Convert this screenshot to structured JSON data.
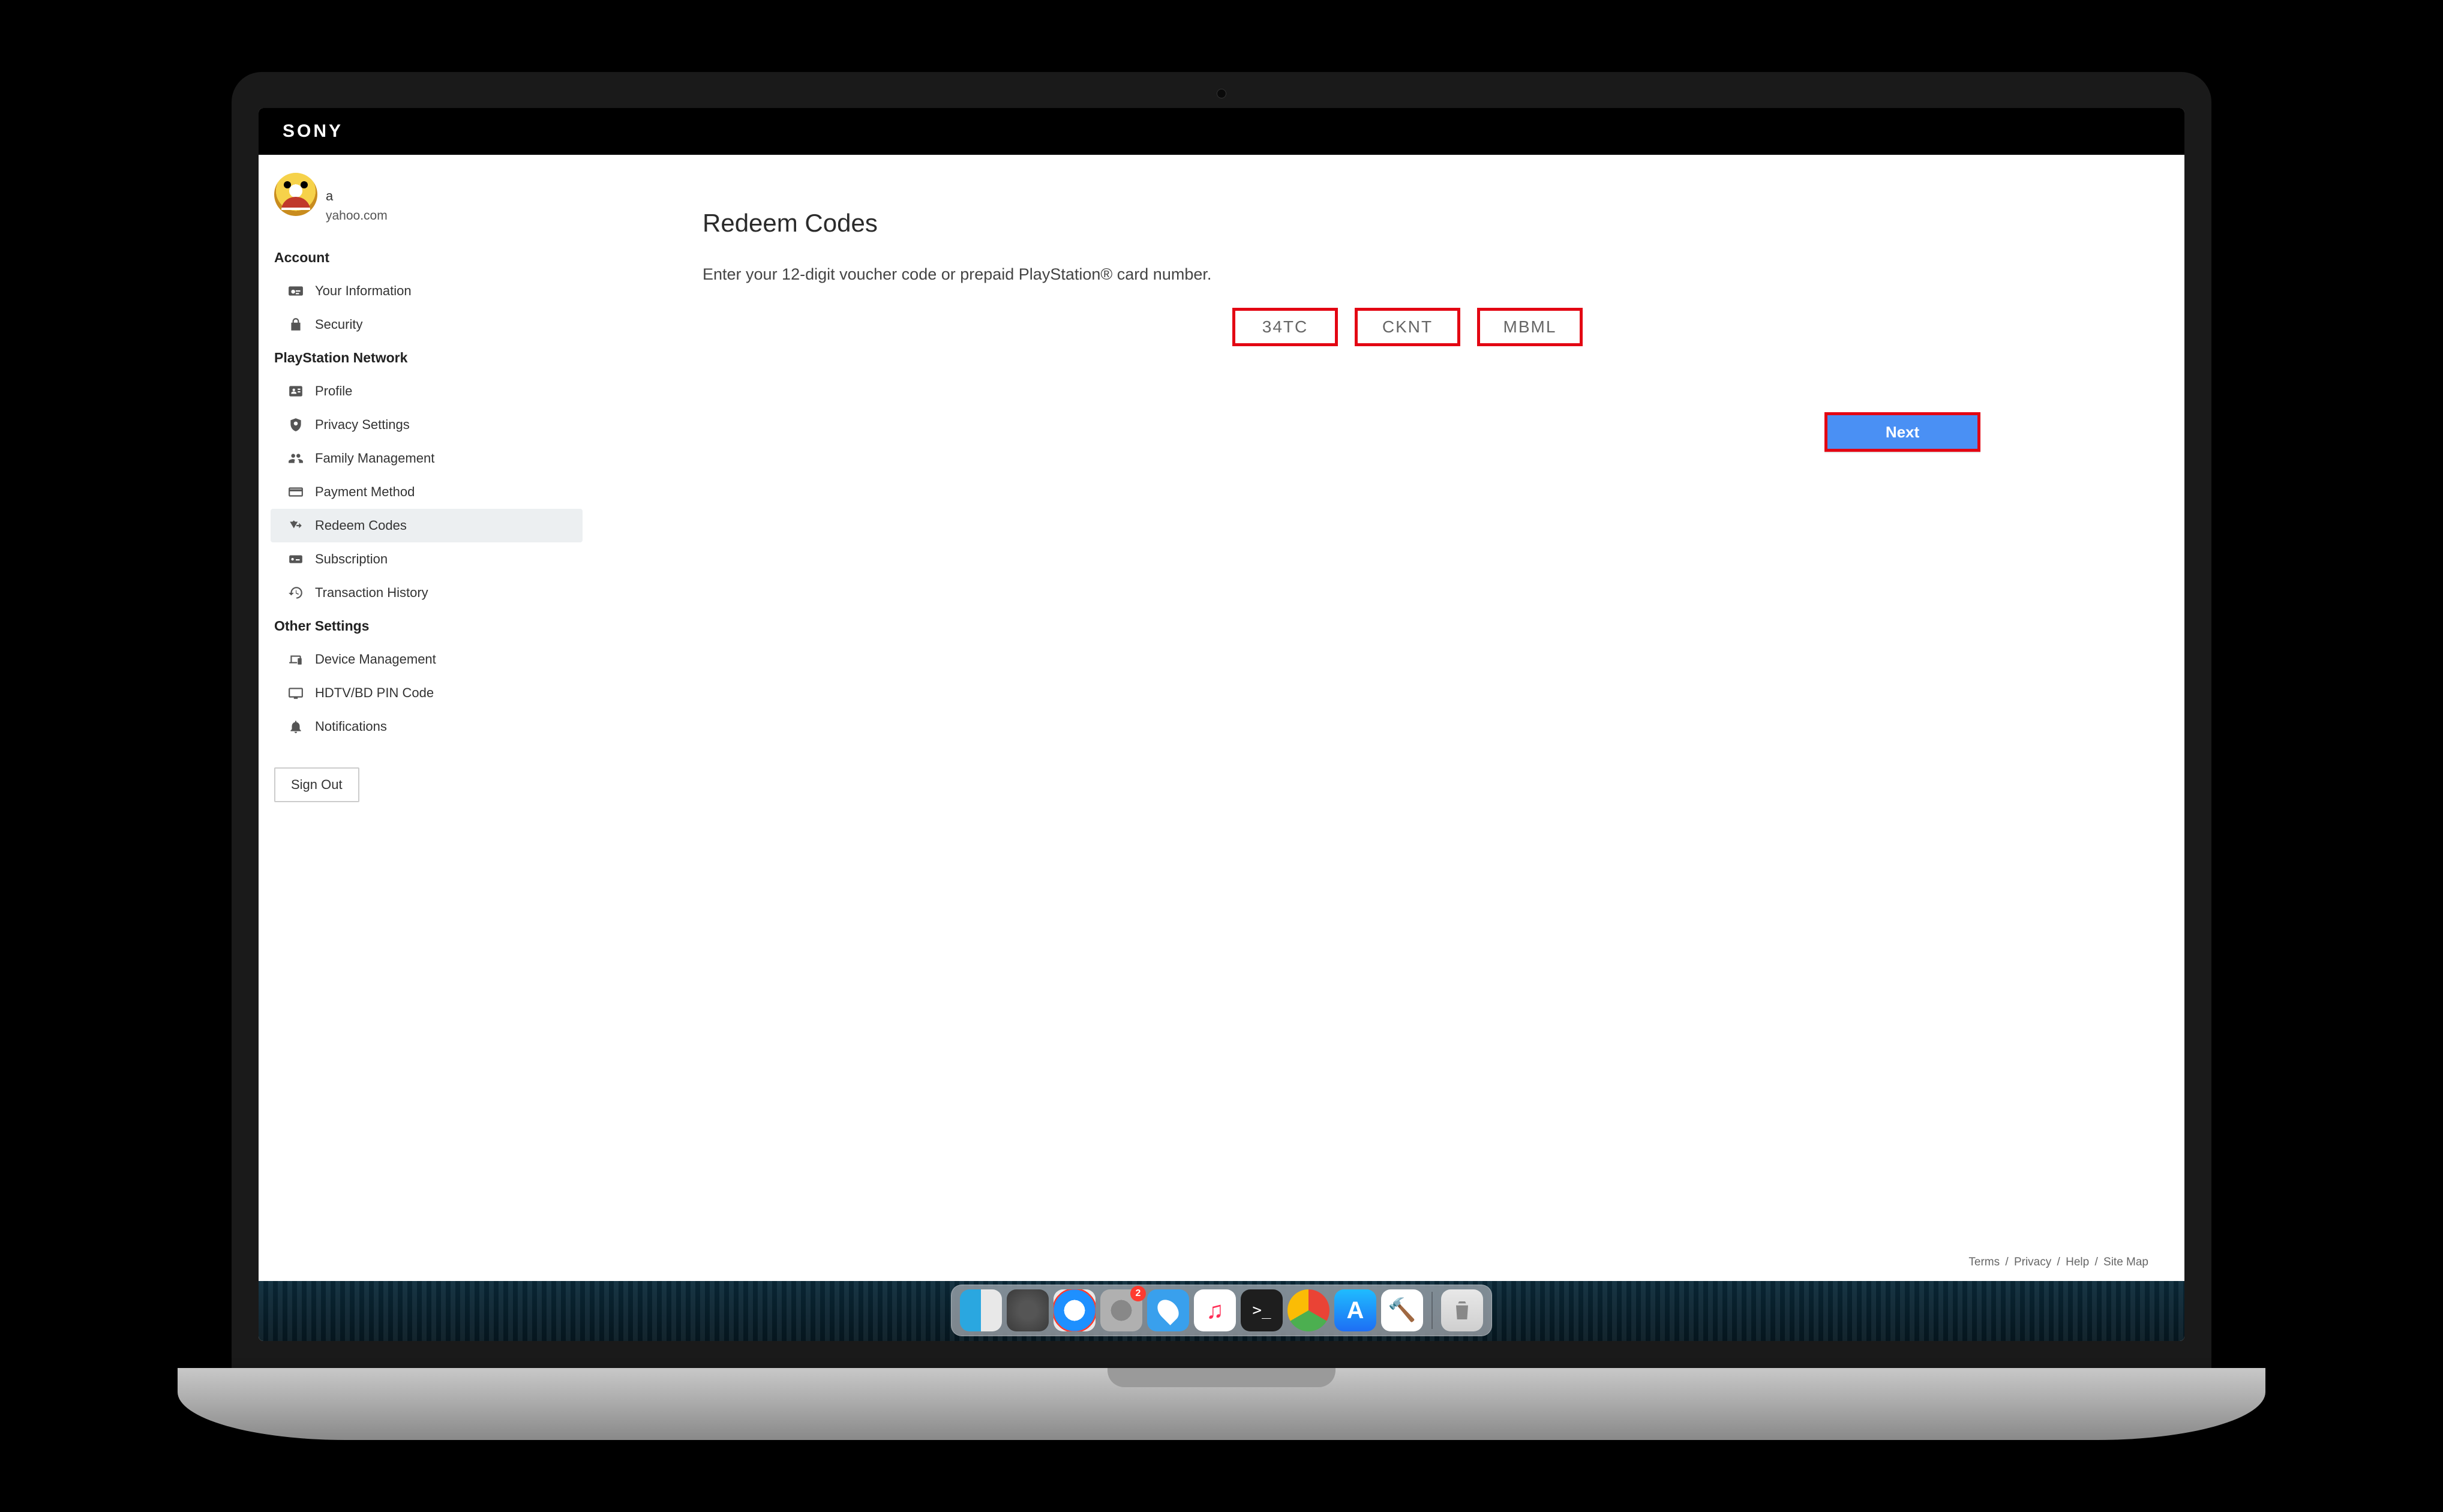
{
  "brand": "SONY",
  "user": {
    "name_masked": "",
    "line2_prefix": "a",
    "email_suffix": "yahoo.com"
  },
  "sidebar": {
    "sections": {
      "account": {
        "label": "Account"
      },
      "psn": {
        "label": "PlayStation Network"
      },
      "other": {
        "label": "Other Settings"
      }
    },
    "items": {
      "your_info": "Your Information",
      "security": "Security",
      "profile": "Profile",
      "privacy": "Privacy Settings",
      "family": "Family Management",
      "payment": "Payment Method",
      "redeem": "Redeem Codes",
      "subscription": "Subscription",
      "transactions": "Transaction History",
      "device_mgmt": "Device Management",
      "hdtv_pin": "HDTV/BD PIN Code",
      "notifications": "Notifications"
    },
    "signout": "Sign Out"
  },
  "main": {
    "title": "Redeem Codes",
    "instruction": "Enter your 12-digit voucher code or prepaid PlayStation® card number.",
    "code_parts": [
      "34TC",
      "CKNT",
      "MBML"
    ],
    "next_label": "Next"
  },
  "footer": {
    "terms": "Terms",
    "privacy": "Privacy",
    "help": "Help",
    "sitemap": "Site Map",
    "sep": " / "
  },
  "dock": {
    "badge_settings": "2",
    "items": [
      "finder",
      "launchpad",
      "safari",
      "settings",
      "maps",
      "music",
      "terminal",
      "chrome",
      "appstore",
      "xcode",
      "trash"
    ]
  }
}
